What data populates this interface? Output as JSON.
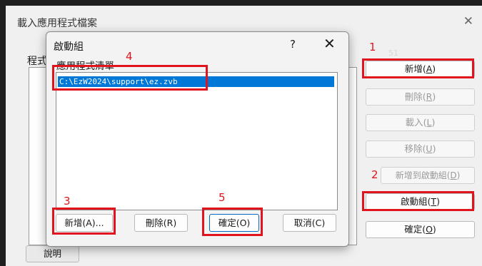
{
  "outer_window": {
    "title": "載入應用程式檔案",
    "group_label": "程式",
    "buttons": {
      "add": {
        "text": "新增(",
        "key": "A",
        "end": ")"
      },
      "delete": {
        "text": "刪除(",
        "key": "R",
        "end": ")"
      },
      "load": {
        "text": "載入(",
        "key": "L",
        "end": ")"
      },
      "remove": {
        "text": "移除(",
        "key": "U",
        "end": ")"
      },
      "add_to_startup": {
        "text": "新增到啟動組(",
        "key": "D",
        "end": ")"
      },
      "startup_group": {
        "text": "啟動組(",
        "key": "T",
        "end": ")"
      },
      "ok": {
        "text": "確定(",
        "key": "O",
        "end": ")"
      },
      "help": "說明"
    },
    "faint_counter": "51"
  },
  "dialog": {
    "title": "啟動組",
    "help_glyph": "?",
    "close_glyph": "✕",
    "list_label": "應用程式清單",
    "items": [
      "C:\\EzW2024\\support\\ez.zvb"
    ],
    "buttons": {
      "add": "新增(A)...",
      "delete": "刪除(R)",
      "ok": "確定(O)",
      "cancel": "取消(C)"
    }
  },
  "annotations": [
    "1",
    "2",
    "3",
    "4",
    "5"
  ],
  "colors": {
    "highlight": "#e0141e",
    "selection": "#0078d7"
  }
}
